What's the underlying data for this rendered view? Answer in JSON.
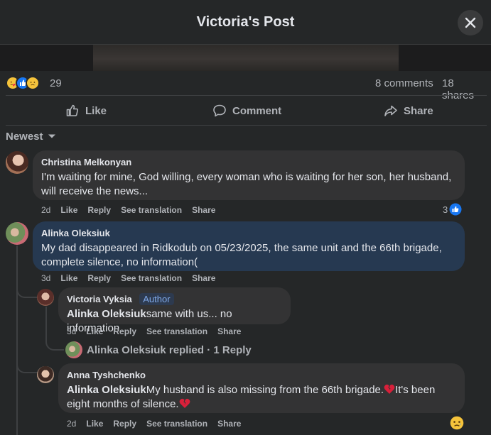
{
  "header": {
    "title": "Victoria's Post"
  },
  "stats": {
    "reaction_count": "29",
    "comments": "8 comments",
    "shares": "18 shares"
  },
  "actions": {
    "like": "Like",
    "comment": "Comment",
    "share": "Share"
  },
  "sort": {
    "label": "Newest"
  },
  "comments": [
    {
      "author": "Christina Melkonyan",
      "text": "I'm waiting for mine, God willing, every woman who is waiting for her son, her husband, will receive the news...",
      "time": "2d",
      "like": "Like",
      "reply": "Reply",
      "translate": "See translation",
      "share": "Share",
      "likes": "3"
    },
    {
      "author": "Alinka Oleksiuk",
      "text": "My dad disappeared in Ridkodub on 05/23/2025, the same unit and the 66th brigade, complete silence, no information(",
      "time": "3d",
      "like": "Like",
      "reply": "Reply",
      "translate": "See translation",
      "share": "Share"
    }
  ],
  "replies": [
    {
      "author": "Victoria Vyksia",
      "badge": "Author",
      "mention": "Alinka Oleksiuk",
      "text": "same with us... no information",
      "time": "3d",
      "like": "Like",
      "reply": "Reply",
      "translate": "See translation",
      "share": "Share",
      "replied_text": "Alinka Oleksiuk replied · 1 Reply"
    },
    {
      "author": "Anna Tyshchenko",
      "mention": "Alinka Oleksiuk",
      "text_part1": "My husband is also missing from the 66th brigade.",
      "text_part2": "It's been eight months of silence.",
      "time": "2d",
      "like": "Like",
      "reply": "Reply",
      "translate": "See translation",
      "share": "Share"
    }
  ],
  "colors": {
    "background": "#252728",
    "bubble": "#333334",
    "bubble_highlight": "#263951",
    "like_blue": "#1877f2"
  },
  "icons": [
    "close-icon",
    "love-reaction-icon",
    "like-reaction-icon",
    "sad-reaction-icon",
    "thumbs-up-icon",
    "comment-icon",
    "share-icon",
    "caret-down-icon",
    "broken-heart-icon"
  ]
}
